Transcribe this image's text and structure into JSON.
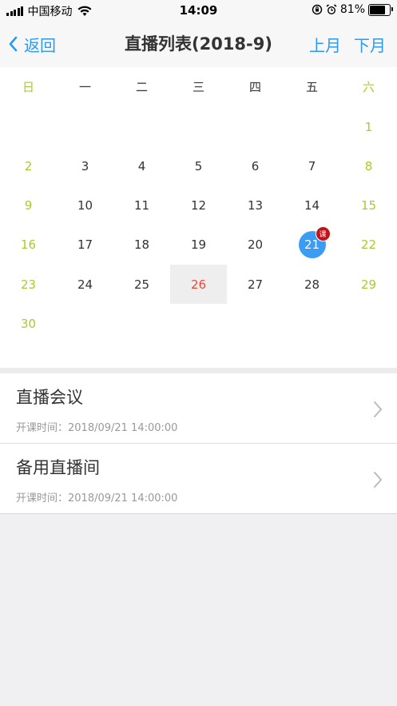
{
  "status_bar": {
    "carrier": "中国移动",
    "time": "14:09",
    "battery": "81%",
    "battery_level": 0.81
  },
  "nav": {
    "back_label": "返回",
    "title": "直播列表(2018-9)",
    "prev_month": "上月",
    "next_month": "下月"
  },
  "calendar": {
    "weekdays": [
      "日",
      "一",
      "二",
      "三",
      "四",
      "五",
      "六"
    ],
    "days": [
      [
        "",
        "",
        "",
        "",
        "",
        "",
        "1"
      ],
      [
        "2",
        "3",
        "4",
        "5",
        "6",
        "7",
        "8"
      ],
      [
        "9",
        "10",
        "11",
        "12",
        "13",
        "14",
        "15"
      ],
      [
        "16",
        "17",
        "18",
        "19",
        "20",
        "21",
        "22"
      ],
      [
        "23",
        "24",
        "25",
        "26",
        "27",
        "28",
        "29"
      ],
      [
        "30",
        "",
        "",
        "",
        "",
        "",
        ""
      ]
    ],
    "today": "26",
    "selected": "21",
    "badge_label": "课",
    "weekend_color": "#a9cb28",
    "accent_color": "#3a9df3",
    "today_color": "#e64a3b"
  },
  "live_list": {
    "items": [
      {
        "title": "直播会议",
        "time": "开课时间：2018/09/21 14:00:00"
      },
      {
        "title": "备用直播间",
        "time": "开课时间：2018/09/21 14:00:00"
      }
    ]
  }
}
